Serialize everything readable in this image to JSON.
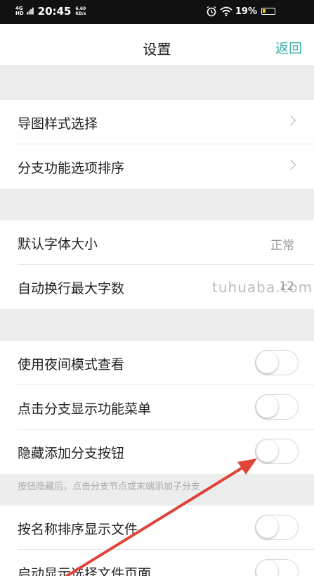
{
  "status_bar": {
    "network": "4G",
    "network_sub": "HD",
    "time": "20:45",
    "speed_value": "6.60",
    "speed_unit": "KB/s",
    "battery": "19%"
  },
  "header": {
    "title": "设置",
    "back_label": "返回"
  },
  "groups": [
    {
      "items": [
        {
          "label": "导图样式选择",
          "type": "nav"
        },
        {
          "label": "分支功能选项排序",
          "type": "nav"
        }
      ]
    },
    {
      "items": [
        {
          "label": "默认字体大小",
          "type": "value",
          "value": "正常"
        },
        {
          "label": "自动换行最大字数",
          "type": "value",
          "value": "12"
        }
      ]
    },
    {
      "items": [
        {
          "label": "使用夜间模式查看",
          "type": "toggle",
          "on": false
        },
        {
          "label": "点击分支显示功能菜单",
          "type": "toggle",
          "on": false
        },
        {
          "label": "隐藏添加分支按钮",
          "type": "toggle",
          "on": false
        }
      ],
      "hint": "按钮隐藏后，点击分支节点或末端添加子分支"
    },
    {
      "items": [
        {
          "label": "按名称排序显示文件",
          "type": "toggle",
          "on": false
        },
        {
          "label": "启动显示选择文件页面",
          "type": "toggle",
          "on": false
        }
      ]
    }
  ],
  "watermark": "tuhuaba.com",
  "colors": {
    "accent": "#3fb3a8",
    "background": "#ededed",
    "annotation_arrow": "#e0443a"
  }
}
